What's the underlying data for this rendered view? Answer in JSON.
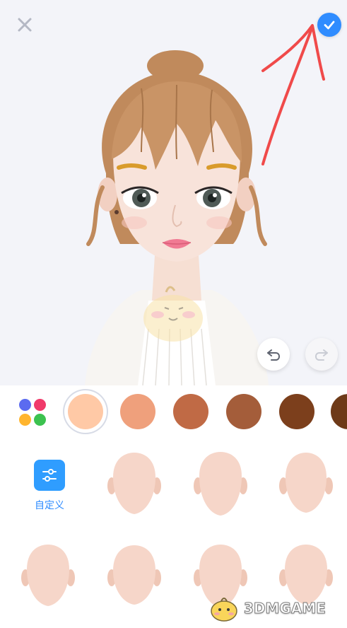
{
  "header": {
    "close_icon": "close-icon",
    "confirm_icon": "checkmark-icon",
    "accent_color": "#2f8cff"
  },
  "annotation": {
    "arrow_color": "#f04a4a"
  },
  "avatar": {
    "undo_icon": "undo-icon",
    "redo_icon": "redo-icon"
  },
  "skin_colors": {
    "palette_icon": "palette-icon",
    "swatches": [
      "#ffc9a6",
      "#efa07c",
      "#c06a45",
      "#a45d3a",
      "#7c3f1c",
      "#6e3a18"
    ],
    "selected_index": 0
  },
  "face_grid": {
    "custom": {
      "icon": "sliders-icon",
      "label": "自定义"
    },
    "faces_count_visible": 7
  },
  "watermark": {
    "text": "3DMGAME"
  }
}
